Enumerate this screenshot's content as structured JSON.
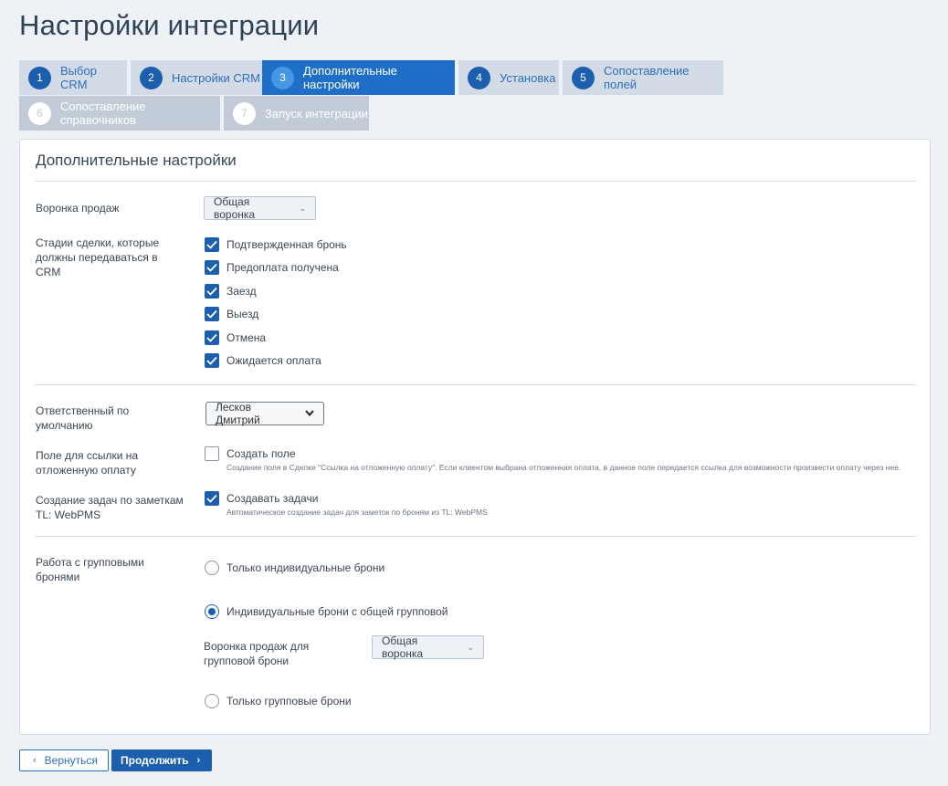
{
  "page": {
    "title": "Настройки интеграции"
  },
  "steps": [
    {
      "num": "1",
      "label": "Выбор CRM"
    },
    {
      "num": "2",
      "label": "Настройки CRM"
    },
    {
      "num": "3",
      "label": "Дополнительные настройки"
    },
    {
      "num": "4",
      "label": "Установка"
    },
    {
      "num": "5",
      "label": "Сопоставление полей"
    },
    {
      "num": "6",
      "label": "Сопоставление справочников"
    },
    {
      "num": "7",
      "label": "Запуск интеграции"
    }
  ],
  "card": {
    "title": "Дополнительные настройки",
    "sales_funnel": {
      "label": "Воронка продаж",
      "value": "Общая воронка"
    },
    "stages": {
      "label": "Стадии сделки, которые должны передаваться в CRM",
      "items": [
        {
          "label": "Подтвержденная бронь",
          "checked": true
        },
        {
          "label": "Предоплата получена",
          "checked": true
        },
        {
          "label": "Заезд",
          "checked": true
        },
        {
          "label": "Выезд",
          "checked": true
        },
        {
          "label": "Отмена",
          "checked": true
        },
        {
          "label": "Ожидается оплата",
          "checked": true
        }
      ]
    },
    "responsible": {
      "label": "Ответственный по умолчанию",
      "value": "Лесков Дмитрий"
    },
    "deferred_link": {
      "label": "Поле для ссылки на отложенную оплату",
      "checkbox_label": "Создать поле",
      "checked": false,
      "hint": "Создание поля в Сделке \"Ссылка на отложенную оплату\". Если клиентом выбрана отложенная оплата, в данное поле передается ссылка для возможности произвести оплату через нее."
    },
    "tasks": {
      "label": "Создание задач по заметкам TL: WebPMS",
      "checkbox_label": "Создавать задачи",
      "checked": true,
      "hint": "Автоматическое создание задач для заметок по броням из TL: WebPMS"
    },
    "group": {
      "label": "Работа с групповыми бронями",
      "options": [
        {
          "label": "Только индивидуальные брони",
          "selected": false
        },
        {
          "label": "Индивидуальные брони с общей групповой",
          "selected": true
        },
        {
          "label": "Только групповые брони",
          "selected": false
        }
      ],
      "group_funnel": {
        "label": "Воронка продаж для групповой брони",
        "value": "Общая воронка"
      }
    }
  },
  "footer": {
    "back_label": "Вернуться",
    "next_label": "Продолжить"
  },
  "colors": {
    "primary": "#1c5fae",
    "active_tab": "#1f6fc9",
    "tab_bg": "#d3dbe6",
    "disabled_tab": "#c2ccd8"
  }
}
